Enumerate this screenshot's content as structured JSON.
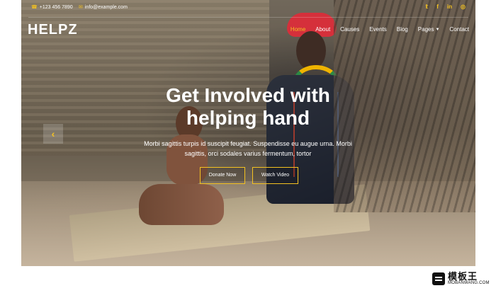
{
  "header": {
    "phone": "+123 456 7890",
    "email": "info@example.com",
    "brand": "HELPZ",
    "socials": [
      {
        "name": "twitter-icon",
        "label": "𝕥"
      },
      {
        "name": "facebook-icon",
        "label": "f"
      },
      {
        "name": "linkedin-icon",
        "label": "in"
      },
      {
        "name": "instagram-icon",
        "label": "◎"
      }
    ],
    "nav": [
      {
        "label": "Home",
        "active": true
      },
      {
        "label": "About",
        "active": false
      },
      {
        "label": "Causes",
        "active": false
      },
      {
        "label": "Events",
        "active": false
      },
      {
        "label": "Blog",
        "active": false
      },
      {
        "label": "Pages",
        "active": false,
        "dropdown": true
      },
      {
        "label": "Contact",
        "active": false
      }
    ]
  },
  "hero": {
    "title_line_1": "Get Involved with",
    "title_line_2": "helping hand",
    "subtitle": "Morbi sagittis turpis id suscipit feugiat. Suspendisse eu augue urna. Morbi sagittis, orci sodales varius fermentum, tortor",
    "buttons": [
      {
        "label": "Donate Now"
      },
      {
        "label": "Watch Video"
      }
    ],
    "prev_arrow": "‹",
    "next_arrow": "›"
  },
  "watermark": {
    "title": "模板王",
    "subtitle": "MOBANWANG.COM"
  },
  "colors": {
    "accent": "#f4c221",
    "text": "#ffffff",
    "overlay": "#181818"
  }
}
